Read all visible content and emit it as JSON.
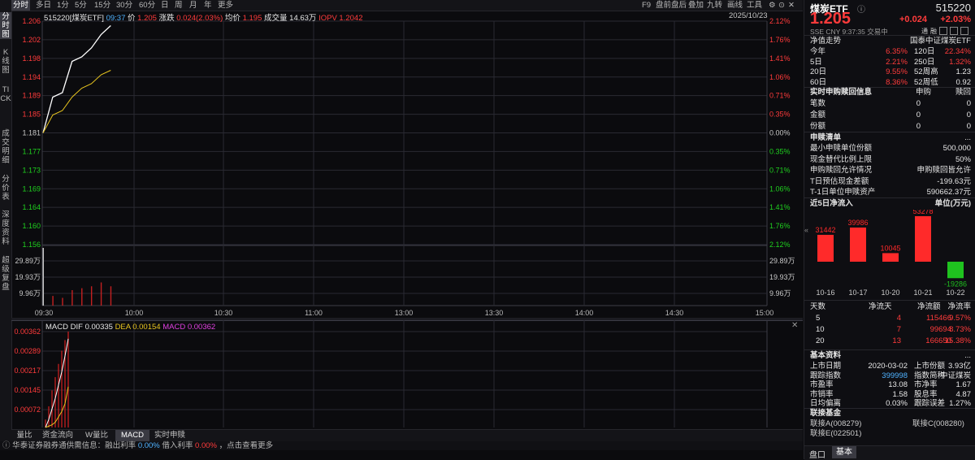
{
  "toolbar": {
    "periods": [
      "分时",
      "多日",
      "1分",
      "5分",
      "15分",
      "30分",
      "60分",
      "日",
      "周",
      "月",
      "年",
      "更多"
    ],
    "right": [
      "F9",
      "盘前盘后",
      "叠加",
      "九转",
      "画线",
      "工具"
    ],
    "date": "2025/10/23"
  },
  "leftbar": [
    "分时图",
    "K线图",
    "TICK",
    "成交明细",
    "分价表",
    "深度资料",
    "超级复盘"
  ],
  "quote_line": {
    "code_name": "515220[煤炭ETF]",
    "time": "09:37",
    "price_label": "价",
    "price": "1.205",
    "change_label": "涨跌",
    "change": "0.024(2.03%)",
    "avg_label": "均价",
    "avg": "1.195",
    "vol_label": "成交量",
    "vol": "14.63万",
    "iopv_label": "IOPV",
    "iopv": "1.2042"
  },
  "price_axis": {
    "left": [
      "1.206",
      "1.202",
      "1.198",
      "1.194",
      "1.189",
      "1.185",
      "1.181",
      "1.177",
      "1.173",
      "1.169",
      "1.164",
      "1.160",
      "1.156"
    ],
    "right": [
      "2.12%",
      "1.76%",
      "1.41%",
      "1.06%",
      "0.71%",
      "0.35%",
      "0.00%",
      "0.35%",
      "0.71%",
      "1.06%",
      "1.41%",
      "1.76%",
      "2.12%"
    ]
  },
  "vol_axis": {
    "left": [
      "29.89万",
      "19.93万",
      "9.96万"
    ],
    "right": [
      "29.89万",
      "19.93万",
      "9.96万"
    ]
  },
  "time_axis": [
    "09:30",
    "10:00",
    "10:30",
    "11:00",
    "13:00",
    "13:30",
    "14:00",
    "14:30",
    "15:00"
  ],
  "chart_data": {
    "type": "line",
    "x": [
      "09:30",
      "09:31",
      "09:32",
      "09:33",
      "09:34",
      "09:35",
      "09:36",
      "09:37"
    ],
    "series": [
      {
        "values": [
          1.181,
          1.189,
          1.19,
          1.197,
          1.198,
          1.2,
          1.203,
          1.205
        ],
        "color": "#ffffff"
      },
      {
        "values": [
          1.181,
          1.185,
          1.186,
          1.189,
          1.191,
          1.192,
          1.194,
          1.195
        ],
        "color": "#e8c51f"
      }
    ],
    "volume_bars": [
      29.89,
      5,
      4,
      8,
      9,
      10,
      12,
      10
    ],
    "macd": {
      "dif": "0.00335",
      "dea": "0.00154",
      "macd": "0.00362"
    },
    "ylim": [
      1.156,
      1.206
    ],
    "xlim": [
      "09:30",
      "15:00"
    ]
  },
  "macd_axis": [
    "0.00362",
    "0.00289",
    "0.00217",
    "0.00145",
    "0.00072"
  ],
  "macd_label": {
    "title": "MACD",
    "dif_label": "DIF",
    "dif": "0.00335",
    "dea_label": "DEA",
    "dea": "0.00154",
    "macd_label": "MACD",
    "macd": "0.00362"
  },
  "bottom_tabs": [
    "量比",
    "资金流向",
    "W量比",
    "MACD",
    "实时申赎"
  ],
  "status": {
    "prefix": "华泰证券融券通供需信息：融出利率",
    "rate1": "0.00%",
    "mid": "借入利率",
    "rate2": "0.00%",
    "suffix": "，点击查看更多"
  },
  "right": {
    "name": "煤炭ETF",
    "code": "515220",
    "price": "1.205",
    "change": "+0.024",
    "pct": "+2.03%",
    "sub": "SSE  CNY  9:37:35 交易中",
    "tags": [
      "通",
      "融"
    ],
    "nav_title": "净值走势",
    "index_name": "国泰中证煤炭ETF",
    "perf": [
      {
        "l": "今年",
        "v": "6.35%",
        "l2": "120日",
        "v2": "22.34%"
      },
      {
        "l": "5日",
        "v": "2.21%",
        "l2": "250日",
        "v2": "1.32%"
      },
      {
        "l": "20日",
        "v": "9.55%",
        "l2": "52周高",
        "v2": "1.23"
      },
      {
        "l": "60日",
        "v": "8.36%",
        "l2": "52周低",
        "v2": "0.92"
      }
    ],
    "sub_title": "实时申购赎回信息",
    "sub_cols": [
      "申购",
      "赎回"
    ],
    "sub_rows": [
      {
        "l": "笔数",
        "a": "0",
        "b": "0"
      },
      {
        "l": "金额",
        "a": "0",
        "b": "0"
      },
      {
        "l": "份额",
        "a": "0",
        "b": "0"
      }
    ],
    "list_title": "申赎清单",
    "more": "...",
    "list_rows": [
      {
        "l": "最小申赎单位份额",
        "v": "500,000"
      },
      {
        "l": "现金替代比例上限",
        "v": "50%"
      },
      {
        "l": "申购赎回允许情况",
        "v": "申购赎回皆允许"
      },
      {
        "l": "T日预估现金差额",
        "v": "-199.63元"
      },
      {
        "l": "T-1日单位申赎资产",
        "v": "590662.37元"
      }
    ],
    "flow_title": "近5日净流入",
    "flow_unit": "单位(万元)",
    "flow_bars": [
      {
        "date": "10-16",
        "value": 31442
      },
      {
        "date": "10-17",
        "value": 39986
      },
      {
        "date": "10-20",
        "value": 10045
      },
      {
        "date": "10-21",
        "value": 53278
      },
      {
        "date": "10-22",
        "value": -19286
      }
    ],
    "flow_cols": [
      "天数",
      "净流天",
      "净流额",
      "净流率"
    ],
    "flow_rows": [
      {
        "d": "5",
        "n": "4",
        "a": "115466",
        "r": "9.57%"
      },
      {
        "d": "10",
        "n": "7",
        "a": "99694",
        "r": "8.73%"
      },
      {
        "d": "20",
        "n": "13",
        "a": "166650",
        "r": "15.38%"
      }
    ],
    "basic_title": "基本资料",
    "basic_rows": [
      {
        "l": "上市日期",
        "v": "2020-03-02",
        "l2": "上市份额",
        "v2": "3.93亿"
      },
      {
        "l": "跟踪指数",
        "v": "399998",
        "l2": "指数简称",
        "v2": "中证煤炭"
      },
      {
        "l": "市盈率",
        "v": "13.08",
        "l2": "市净率",
        "v2": "1.67"
      },
      {
        "l": "市销率",
        "v": "1.58",
        "l2": "股息率",
        "v2": "4.87"
      },
      {
        "l": "日均偏离",
        "v": "0.03%",
        "l2": "跟踪误差",
        "v2": "1.27%"
      }
    ],
    "link_title": "联接基金",
    "links": [
      "联接A(008279)",
      "联接C(008280)",
      "联接E(022501)"
    ],
    "tabs": [
      "盘口",
      "基本"
    ]
  }
}
